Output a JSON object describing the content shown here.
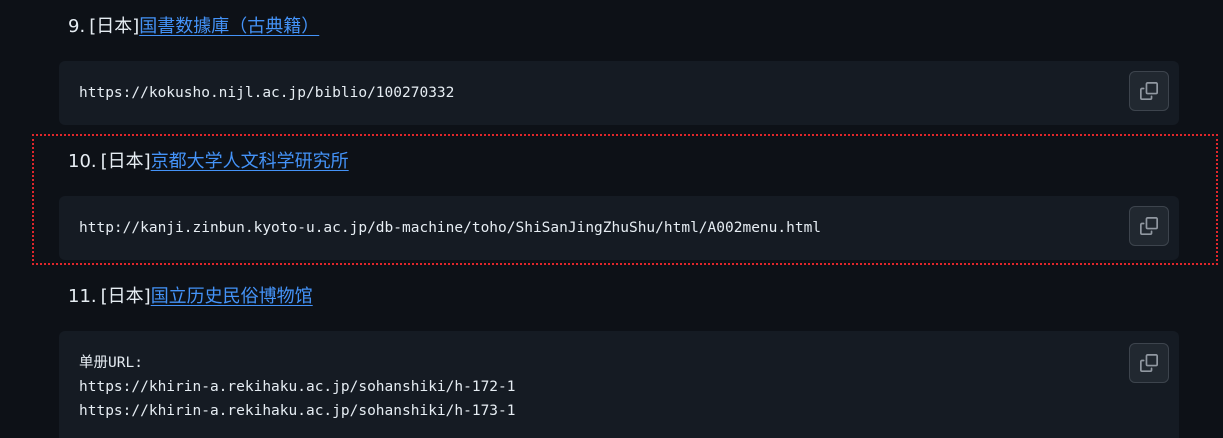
{
  "items": [
    {
      "number": "9.",
      "prefix": "[日本]",
      "link_text": "国書数據庫（古典籍）",
      "code_lines": [
        "https://kokusho.nijl.ac.jp/biblio/100270332"
      ]
    },
    {
      "number": "10.",
      "prefix": "[日本]",
      "link_text": "京都大学人文科学研究所",
      "code_lines": [
        "http://kanji.zinbun.kyoto-u.ac.jp/db-machine/toho/ShiSanJingZhuShu/html/A002menu.html"
      ]
    },
    {
      "number": "11.",
      "prefix": "[日本]",
      "link_text": "国立历史民俗博物馆",
      "code_lines": [
        "单册URL:",
        "https://khirin-a.rekihaku.ac.jp/sohanshiki/h-172-1",
        "https://khirin-a.rekihaku.ac.jp/sohanshiki/h-173-1"
      ]
    }
  ],
  "copy_icon": "copy-icon",
  "colors": {
    "background": "#0d1117",
    "code_background": "#151b23",
    "link": "#4493f8",
    "highlight_border": "#e0262b"
  }
}
